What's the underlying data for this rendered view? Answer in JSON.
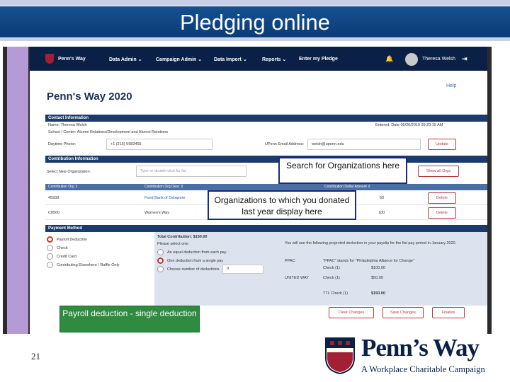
{
  "slide": {
    "title": "Pledging online",
    "page_number": "21"
  },
  "nav": {
    "brand": "Penn's Way",
    "items": [
      "Data Admin ⌄",
      "Campaign Admin ⌄",
      "Data Import ⌄",
      "Reports ⌄",
      "Enter my Pledge"
    ],
    "user": "Theresa Welsh"
  },
  "page": {
    "help": "Help",
    "heading": "Penn's Way 2020"
  },
  "contact": {
    "header": "Contact Information",
    "name": "Name: Theresa Welsh",
    "entered": "Entered: Date 05/20/2019 09:20:15 AM",
    "school": "School / Center: Alumni Relations/Development and Alumni Relations",
    "phone_label": "Daytime Phone:",
    "phone_value": "+1 (215) 5983465",
    "email_label": "UPenn Email Address:",
    "email_value": "welsh@upenn.edu",
    "update_button": "Update"
  },
  "contribution": {
    "header": "Contribution Information",
    "select_label": "Select New Organization:",
    "select_placeholder": "Type or double-click for list",
    "show_all_button": "Show all Orgs",
    "columns": [
      "Contribution Org ⇕",
      "Contribution Org Desc ⇕",
      "Contribution Dollar Amount ⇕"
    ],
    "rows": [
      {
        "org": "45939",
        "desc": "Food Bank of Delaware",
        "amount": "50",
        "action": "Delete"
      },
      {
        "org": "C0500",
        "desc": "Women's Way",
        "amount": "100",
        "action": "Delete"
      }
    ]
  },
  "payment": {
    "header": "Payment Method",
    "methods": [
      "Payroll Deduction",
      "Check",
      "Credit Card",
      "Contributing Elsewhere / Raffle Only"
    ],
    "total": "Total Contribution: $150.00",
    "select_one": "Please select one:",
    "options": [
      "An equal deduction from each pay",
      "One deduction from a single pay",
      "Choose number of deductions"
    ],
    "deductions_value": "0",
    "info": "You will see the following projected deduction in your payslip for the fist pay period in January 2020.",
    "lines": [
      {
        "name": "PPAC",
        "desc": "\"PPAC\" stands for \"Philadelphia Alliance for Change\"",
        "type": "",
        "amount": ""
      },
      {
        "name": "",
        "desc": "",
        "type": "Check (1)",
        "amount": "$100.00"
      },
      {
        "name": "UNITED WAY",
        "desc": "",
        "type": "Check (1)",
        "amount": "$50.00"
      },
      {
        "name": "",
        "desc": "",
        "type": "TTL Check (1)",
        "amount": "$150.00"
      }
    ]
  },
  "actions": {
    "clear": "Clear Changes",
    "save": "Save Changes",
    "finalize": "Finalize"
  },
  "callouts": {
    "search": "Search for Organizations here",
    "orgs": "Organizations to which you donated last year display here",
    "payroll": "Payroll deduction - single deduction"
  },
  "logo": {
    "wordmark": "Penn’s Way",
    "tagline": "A Workplace Charitable Campaign"
  },
  "colors": {
    "title_bar": "#0a3c78",
    "nav": "#0b2046",
    "accent_red": "#b83a3a",
    "callout_green": "#2e8b3f"
  }
}
